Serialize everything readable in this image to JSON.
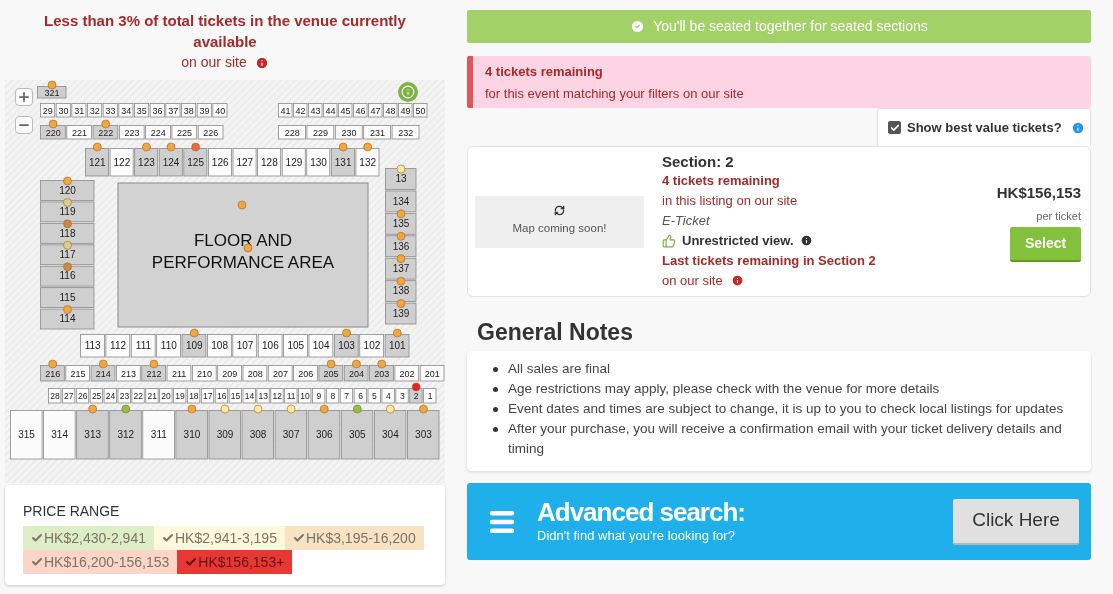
{
  "availability": {
    "title": "Less than 3% of total tickets in the venue currently available",
    "note": "on our site"
  },
  "map": {
    "rows": [
      {
        "sections": [
          {
            "label": "321",
            "shaded": true,
            "color": "#f2a541"
          }
        ]
      },
      {
        "sections": [
          {
            "label": "29",
            "shaded": false
          },
          {
            "label": "30",
            "shaded": false
          },
          {
            "label": "31",
            "shaded": false
          },
          {
            "label": "32",
            "shaded": false
          },
          {
            "label": "33",
            "shaded": false
          },
          {
            "label": "34",
            "shaded": false
          },
          {
            "label": "35",
            "shaded": false
          },
          {
            "label": "36",
            "shaded": false
          },
          {
            "label": "37",
            "shaded": false
          },
          {
            "label": "38",
            "shaded": false
          },
          {
            "label": "39",
            "shaded": false
          },
          {
            "label": "40",
            "shaded": false
          }
        ]
      },
      {
        "sections": [
          {
            "label": "41",
            "shaded": false
          },
          {
            "label": "42",
            "shaded": false
          },
          {
            "label": "43",
            "shaded": false
          },
          {
            "label": "44",
            "shaded": false
          },
          {
            "label": "45",
            "shaded": false
          },
          {
            "label": "46",
            "shaded": false
          },
          {
            "label": "47",
            "shaded": false
          },
          {
            "label": "48",
            "shaded": false
          },
          {
            "label": "49",
            "shaded": false
          },
          {
            "label": "50",
            "shaded": false
          }
        ]
      },
      {
        "sections": [
          {
            "label": "220",
            "shaded": true,
            "color": "#f2a541"
          },
          {
            "label": "221",
            "shaded": false
          },
          {
            "label": "222",
            "shaded": true,
            "color": "#f2a541"
          },
          {
            "label": "223",
            "shaded": false
          },
          {
            "label": "224",
            "shaded": false
          },
          {
            "label": "225",
            "shaded": false
          },
          {
            "label": "226",
            "shaded": false
          }
        ]
      },
      {
        "sections": [
          {
            "label": "228",
            "shaded": false
          },
          {
            "label": "229",
            "shaded": false
          },
          {
            "label": "230",
            "shaded": false
          },
          {
            "label": "231",
            "shaded": false
          },
          {
            "label": "232",
            "shaded": false
          }
        ]
      },
      {
        "sections": [
          {
            "label": "121",
            "shaded": true,
            "color": "#f2a541"
          },
          {
            "label": "122",
            "shaded": false
          },
          {
            "label": "123",
            "shaded": true,
            "color": "#f2a541"
          },
          {
            "label": "124",
            "shaded": true,
            "color": "#f2a541"
          },
          {
            "label": "125",
            "shaded": true,
            "color": "#ee6a3c"
          },
          {
            "label": "126",
            "shaded": false
          },
          {
            "label": "127",
            "shaded": false
          },
          {
            "label": "128",
            "shaded": false
          },
          {
            "label": "129",
            "shaded": false
          },
          {
            "label": "130",
            "shaded": false
          },
          {
            "label": "131",
            "shaded": true,
            "color": "#f2a541"
          },
          {
            "label": "132",
            "shaded": false,
            "color": "#f2a541"
          }
        ]
      },
      {
        "sections": [
          {
            "label": "120",
            "shaded": true,
            "color": "#f2a541"
          },
          {
            "label": "119",
            "shaded": true,
            "color": "#d9cf8a"
          },
          {
            "label": "118",
            "shaded": true,
            "color": "#c98a3e"
          },
          {
            "label": "117",
            "shaded": true,
            "color": "#d9cf8a"
          },
          {
            "label": "116",
            "shaded": true,
            "color": "#c98a3e"
          },
          {
            "label": "115",
            "shaded": true
          },
          {
            "label": "114",
            "shaded": true,
            "color": "#f2a541"
          }
        ]
      },
      {
        "sections": [
          {
            "label": "13",
            "shaded": true,
            "color": "#fbe89c"
          },
          {
            "label": "134",
            "shaded": true
          },
          {
            "label": "135",
            "shaded": true,
            "color": "#f2a541"
          },
          {
            "label": "136",
            "shaded": true,
            "color": "#f2a541"
          },
          {
            "label": "137",
            "shaded": true,
            "color": "#f2a541"
          },
          {
            "label": "138",
            "shaded": true,
            "color": "#f2a541"
          },
          {
            "label": "139",
            "shaded": true,
            "color": "#f2a541"
          }
        ]
      },
      {
        "sections": [
          {
            "label": "113",
            "shaded": false
          },
          {
            "label": "112",
            "shaded": false
          },
          {
            "label": "111",
            "shaded": false
          },
          {
            "label": "110",
            "shaded": false
          },
          {
            "label": "109",
            "shaded": true,
            "color": "#f2a541"
          },
          {
            "label": "108",
            "shaded": false
          },
          {
            "label": "107",
            "shaded": false
          },
          {
            "label": "106",
            "shaded": false
          },
          {
            "label": "105",
            "shaded": false
          },
          {
            "label": "104",
            "shaded": false
          },
          {
            "label": "103",
            "shaded": true,
            "color": "#f2a541"
          },
          {
            "label": "102",
            "shaded": false
          },
          {
            "label": "101",
            "shaded": true,
            "color": "#f2a541"
          }
        ]
      },
      {
        "sections": [
          {
            "label": "216",
            "shaded": true,
            "color": "#f2a541"
          },
          {
            "label": "215",
            "shaded": false
          },
          {
            "label": "214",
            "shaded": true,
            "color": "#f2a541"
          },
          {
            "label": "213",
            "shaded": false
          },
          {
            "label": "212",
            "shaded": true,
            "color": "#f2a541"
          },
          {
            "label": "211",
            "shaded": false
          },
          {
            "label": "210",
            "shaded": false
          },
          {
            "label": "209",
            "shaded": false
          },
          {
            "label": "208",
            "shaded": false
          },
          {
            "label": "207",
            "shaded": false
          },
          {
            "label": "206",
            "shaded": false
          },
          {
            "label": "205",
            "shaded": true,
            "color": "#f2a541"
          },
          {
            "label": "204",
            "shaded": true,
            "color": "#f2a541"
          },
          {
            "label": "203",
            "shaded": true,
            "color": "#f2a541"
          },
          {
            "label": "202",
            "shaded": false
          },
          {
            "label": "201",
            "shaded": false
          }
        ]
      },
      {
        "sections": [
          {
            "label": "28",
            "shaded": false
          },
          {
            "label": "27",
            "shaded": false
          },
          {
            "label": "26",
            "shaded": false
          },
          {
            "label": "25",
            "shaded": false
          },
          {
            "label": "24",
            "shaded": false
          },
          {
            "label": "23",
            "shaded": false
          },
          {
            "label": "22",
            "shaded": false
          },
          {
            "label": "21",
            "shaded": false
          },
          {
            "label": "20",
            "shaded": false
          },
          {
            "label": "19",
            "shaded": false
          },
          {
            "label": "18",
            "shaded": false
          },
          {
            "label": "17",
            "shaded": false
          },
          {
            "label": "16",
            "shaded": false
          },
          {
            "label": "15",
            "shaded": false
          },
          {
            "label": "14",
            "shaded": false
          },
          {
            "label": "13",
            "shaded": false
          },
          {
            "label": "12",
            "shaded": false
          },
          {
            "label": "11",
            "shaded": false
          },
          {
            "label": "10",
            "shaded": false
          },
          {
            "label": "9",
            "shaded": false
          },
          {
            "label": "8",
            "shaded": false
          },
          {
            "label": "7",
            "shaded": false
          },
          {
            "label": "6",
            "shaded": false
          },
          {
            "label": "5",
            "shaded": false
          },
          {
            "label": "4",
            "shaded": false
          },
          {
            "label": "3",
            "shaded": false
          },
          {
            "label": "2",
            "shaded": true,
            "color": "#e3262d"
          },
          {
            "label": "1",
            "shaded": false
          }
        ]
      },
      {
        "sections": [
          {
            "label": "315",
            "shaded": false
          },
          {
            "label": "314",
            "shaded": false
          },
          {
            "label": "313",
            "shaded": true,
            "color": "#f2a541"
          },
          {
            "label": "312",
            "shaded": true,
            "color": "#8bc34a"
          },
          {
            "label": "311",
            "shaded": false
          },
          {
            "label": "310",
            "shaded": true,
            "color": "#f2a541"
          },
          {
            "label": "309",
            "shaded": true,
            "color": "#fbe89c"
          },
          {
            "label": "308",
            "shaded": true,
            "color": "#fbe89c"
          },
          {
            "label": "307",
            "shaded": true,
            "color": "#fbe89c"
          },
          {
            "label": "306",
            "shaded": true,
            "color": "#f2a541"
          },
          {
            "label": "305",
            "shaded": true,
            "color": "#8bc34a"
          },
          {
            "label": "304",
            "shaded": true,
            "color": "#fbe89c"
          },
          {
            "label": "303",
            "shaded": true,
            "color": "#f2a541"
          }
        ]
      }
    ],
    "floor": {
      "lines": [
        "FLOOR AND",
        "PERFORMANCE AREA"
      ],
      "dots": [
        {
          "color": "#f2a541"
        },
        {
          "color": "#f2a541"
        }
      ]
    }
  },
  "price_range": {
    "title": "PRICE RANGE",
    "items": [
      {
        "label": "HK$2,430-2,941",
        "color": "#dcedc8",
        "selected": false
      },
      {
        "label": "HK$2,941-3,195",
        "color": "#fff8dc",
        "selected": false
      },
      {
        "label": "HK$3,195-16,200",
        "color": "#f8e2c4",
        "selected": false
      },
      {
        "label": "HK$16,200-156,153",
        "color": "#fcd5c8",
        "selected": false
      },
      {
        "label": "HK$156,153+",
        "color": "#e53935",
        "selected": true
      }
    ]
  },
  "banner": "You'll be seated together for seated sections",
  "alert": {
    "title": "4 tickets remaining",
    "text": "for this event matching your filters on our site"
  },
  "best_value": {
    "label": "Show best value tickets?",
    "checked": true
  },
  "listing": {
    "map_placeholder": "Map coming soon!",
    "section": "Section: 2",
    "remaining": "4 tickets remaining",
    "remaining_note": "in this listing on our site",
    "delivery": "E-Ticket",
    "view": "Unrestricted view.",
    "last": "Last tickets remaining in Section 2",
    "last_note": "on our site",
    "price": "HK$156,153",
    "price_unit": "per ticket",
    "button": "Select"
  },
  "notes": {
    "title": "General Notes",
    "items": [
      "All sales are final",
      "Age restrictions may apply, please check with the venue for more details",
      "Event dates and times are subject to change, it is up to you to check local listings for updates",
      "After your purchase, you will receive a confirmation email with your ticket delivery details and timing"
    ]
  },
  "advanced": {
    "title": "Advanced search:",
    "subtitle": "Didn't find what you're looking for?",
    "button": "Click Here"
  }
}
